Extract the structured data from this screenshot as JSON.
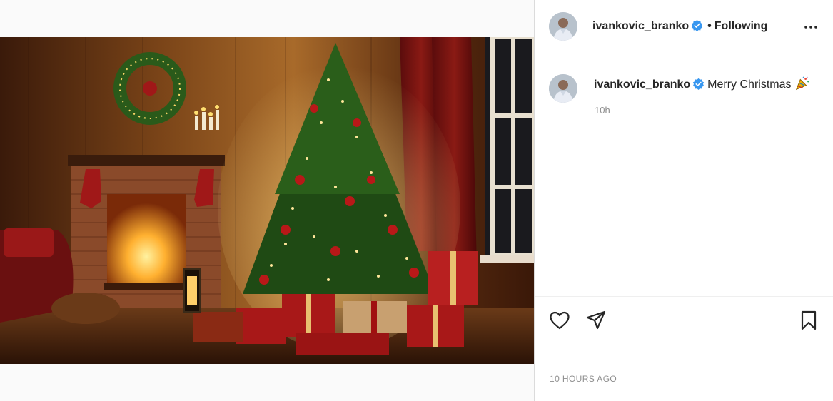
{
  "post": {
    "username": "ivankovic_branko",
    "separator": "•",
    "follow_status": "Following",
    "caption": "Merry Christmas",
    "relative_time": "10h",
    "timestamp": "10 HOURS AGO"
  },
  "icons": {
    "verified": "verified-badge-icon",
    "more": "more-options-icon",
    "emoji": "party-popper-emoji",
    "like": "heart-icon",
    "share": "paper-plane-icon",
    "save": "bookmark-icon"
  },
  "colors": {
    "verified": "#3897f0",
    "text": "#262626",
    "muted": "#8e8e8e",
    "border": "#dbdbdb"
  }
}
